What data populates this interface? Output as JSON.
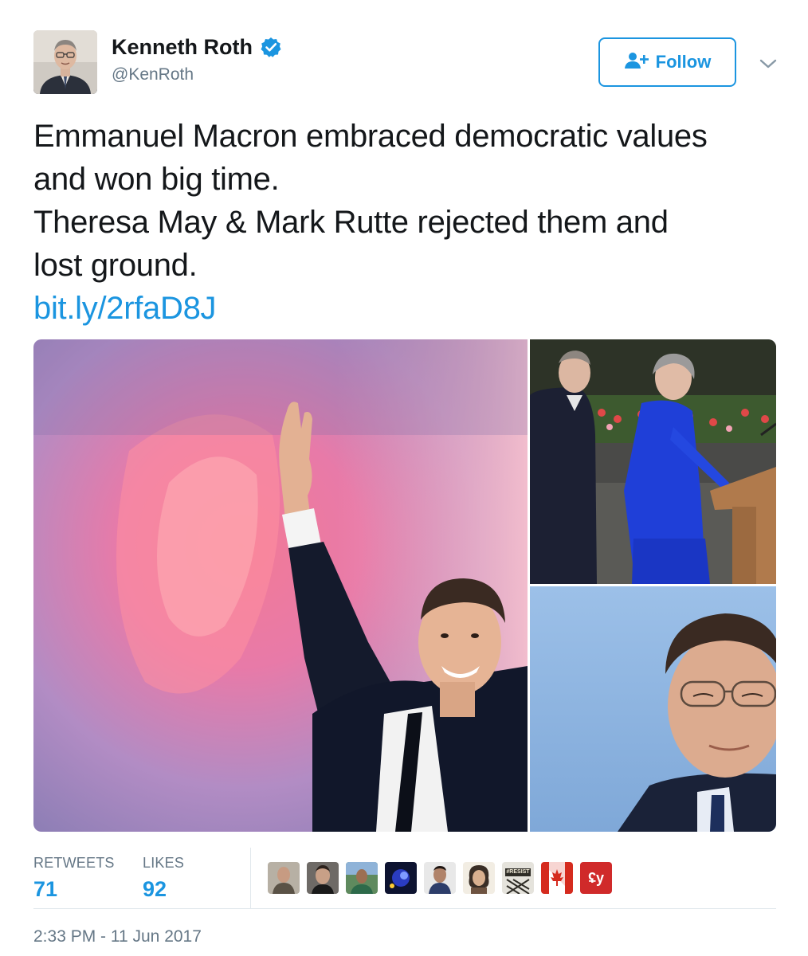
{
  "user": {
    "display_name": "Kenneth Roth",
    "handle": "@KenRoth",
    "verified": true
  },
  "follow_button": {
    "label": "Follow",
    "icon": "add-user-icon"
  },
  "tweet": {
    "lines": [
      "Emmanuel Macron embraced democratic values",
      "and won big time.",
      "Theresa May & Mark Rutte rejected them and",
      "lost ground."
    ],
    "link": "bit.ly/2rfaD8J"
  },
  "stats": {
    "retweets_label": "RETWEETS",
    "retweets_value": "71",
    "likes_label": "LIKES",
    "likes_value": "92"
  },
  "liker_badges": {
    "resist_text": "#RESIST",
    "last_text": "ʢy"
  },
  "timestamp": "2:33 PM - 11 Jun 2017",
  "colors": {
    "accent": "#1b95e0",
    "muted": "#657786",
    "text": "#14171a",
    "divider": "#e1e8ed"
  }
}
